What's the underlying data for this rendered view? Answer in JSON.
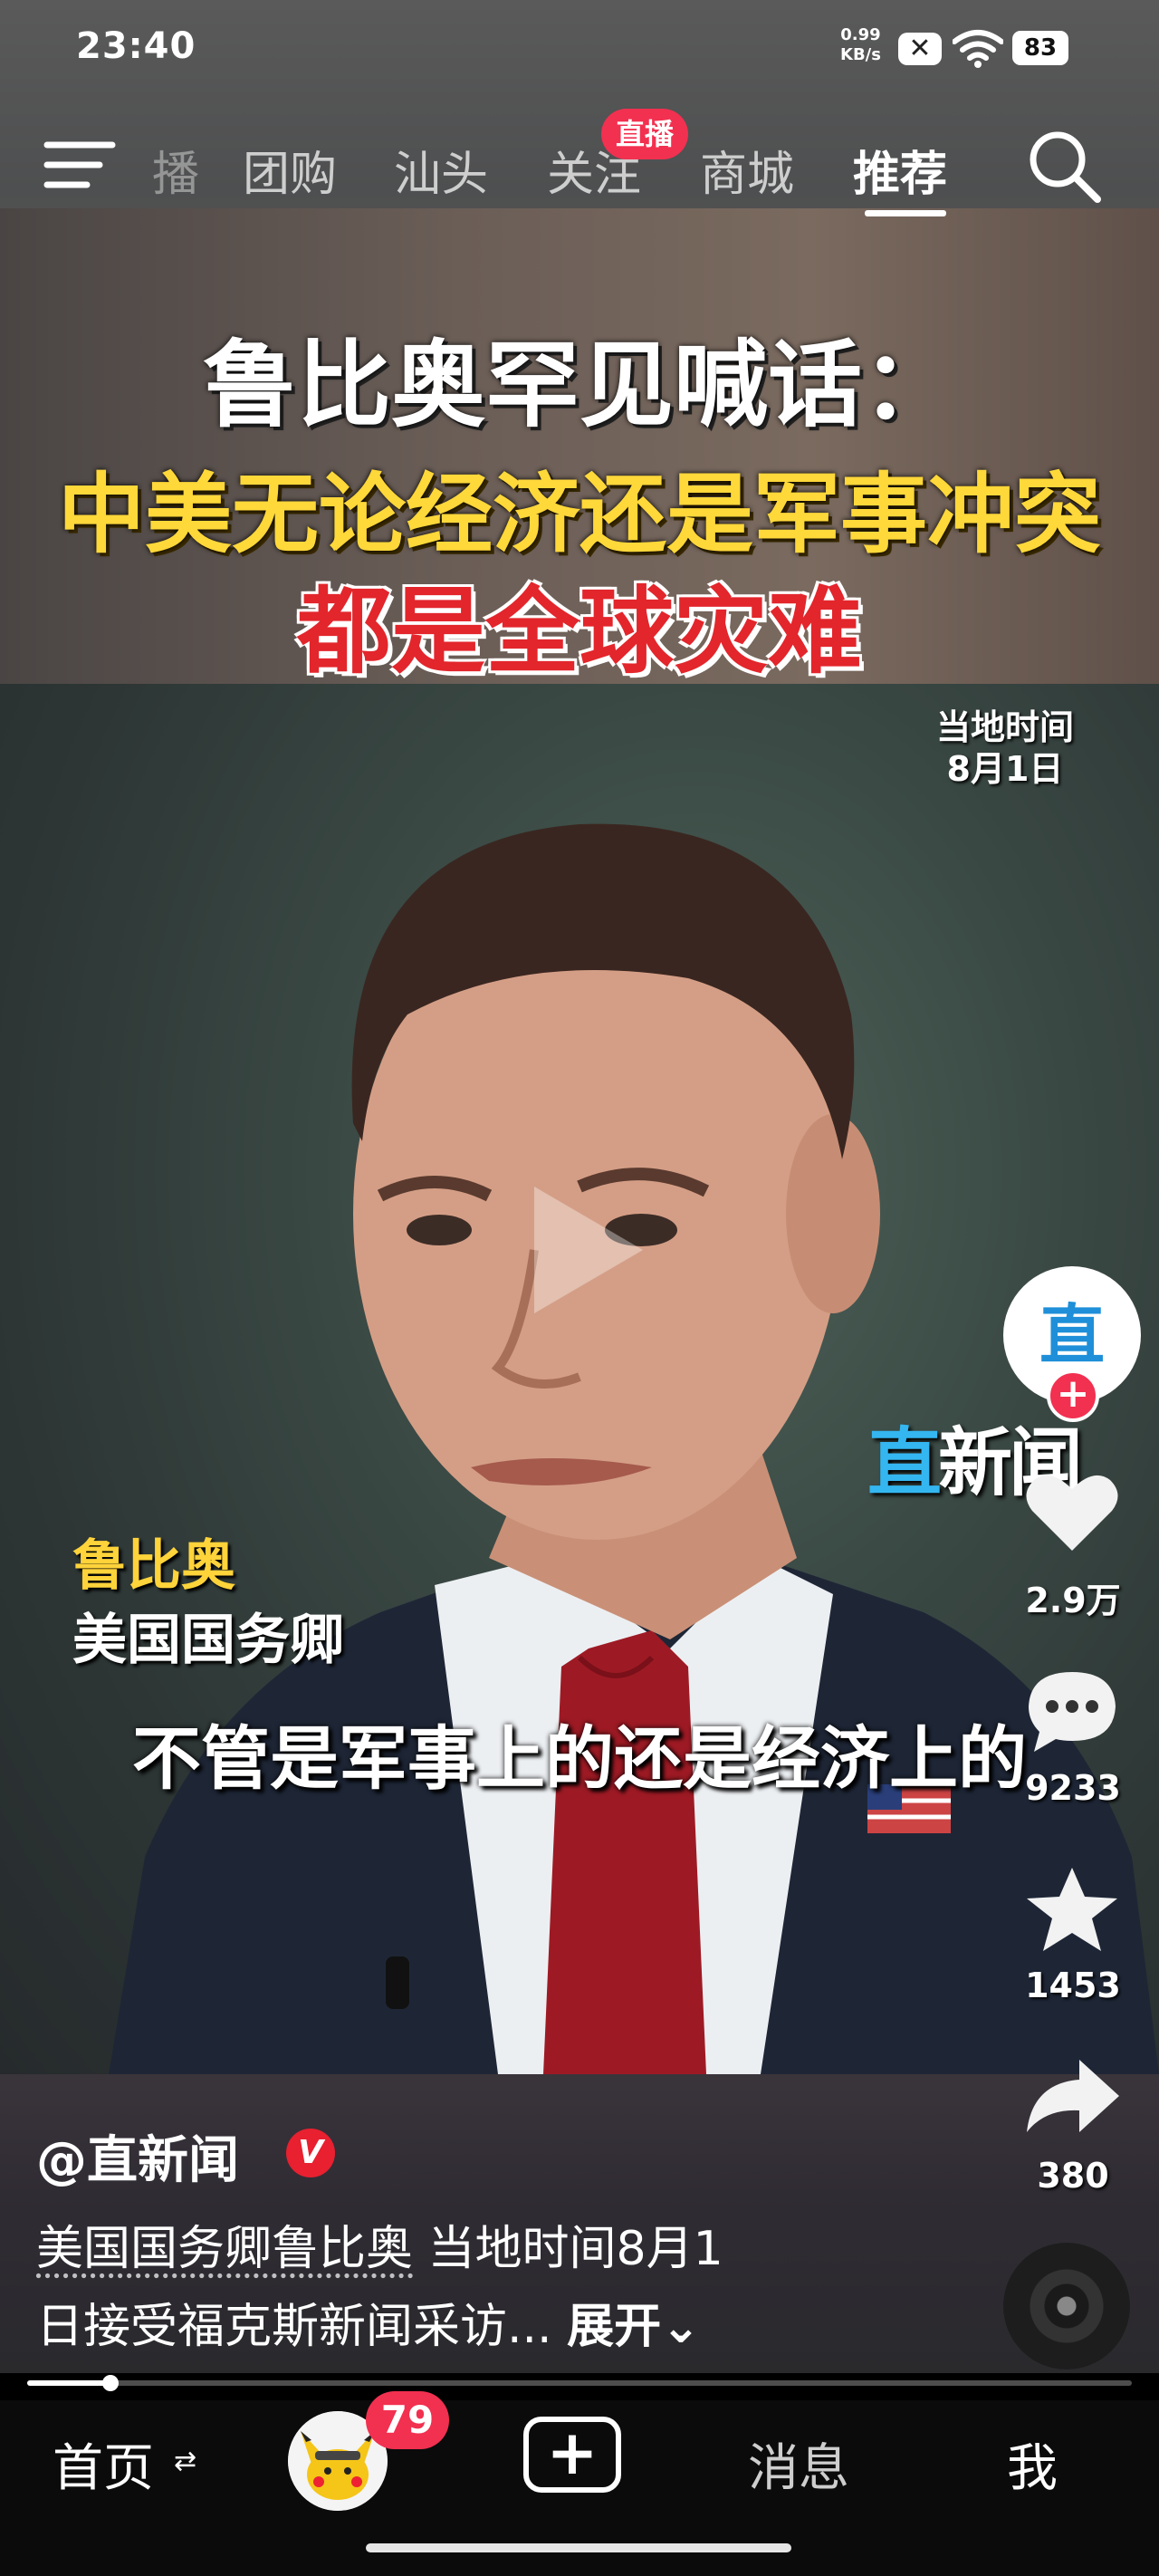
{
  "status_bar": {
    "time": "23:40",
    "net_speed_value": "0.99",
    "net_speed_unit": "KB/s",
    "battery": "83",
    "icons": [
      "close-box-icon",
      "wifi-icon",
      "battery-icon"
    ]
  },
  "top_nav": {
    "tabs": [
      {
        "label": "播"
      },
      {
        "label": "团购"
      },
      {
        "label": "汕头"
      },
      {
        "label": "关注"
      },
      {
        "label": "商城"
      },
      {
        "label": "推荐"
      }
    ],
    "active_tab": "推荐",
    "live_badge": "直播",
    "icons": [
      "menu-icon",
      "search-icon"
    ]
  },
  "video": {
    "headline_line1": "鲁比奥罕见喊话：",
    "headline_line2": "中美无论经济还是军事冲突",
    "headline_line3": "都是全球灾难",
    "timestamp_line1": "当地时间",
    "timestamp_line2": "8月1日",
    "caption_name": "鲁比奥",
    "caption_role": "美国国务卿",
    "subtitle": "不管是军事上的还是经济上的",
    "watermark_zhi": "直",
    "watermark_rest": "新闻",
    "progress_fraction": 0.075
  },
  "side_actions": {
    "avatar_char": "直",
    "follow_plus": "+",
    "like_count": "2.9万",
    "comment_count": "9233",
    "favorite_count": "1453",
    "share_count": "380"
  },
  "post_info": {
    "author": "@直新闻",
    "verified_mark": "V",
    "topic": "美国国务卿鲁比奥",
    "desc_line1_rest": " 当地时间8月1",
    "desc_line2": "日接受福克斯新闻采访... ",
    "expand_label": "展开⌄"
  },
  "bottom_bar": {
    "home": "首页",
    "home_switch": "⇄",
    "badge_count": "79",
    "add": "+",
    "messages": "消息",
    "me": "我"
  },
  "colors": {
    "accent_red": "#f23050",
    "headline_yellow": "#ffd83a",
    "headline_red": "#e2262c",
    "watermark_blue": "#34b6f0"
  }
}
